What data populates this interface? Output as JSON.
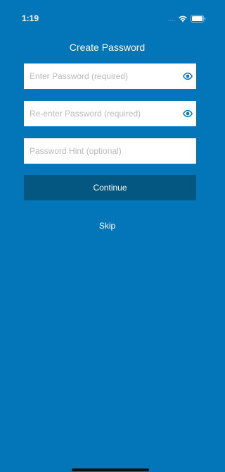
{
  "status_bar": {
    "time": "1:19",
    "signal_text": "....",
    "wifi_icon": "wifi-icon",
    "battery_icon": "battery-icon"
  },
  "title": "Create Password",
  "fields": {
    "password": {
      "placeholder": "Enter Password (required)",
      "value": "",
      "icon": "eye-icon"
    },
    "confirm": {
      "placeholder": "Re-enter Password (required)",
      "value": "",
      "icon": "eye-icon"
    },
    "hint": {
      "placeholder": "Password Hint (optional)",
      "value": ""
    }
  },
  "continue_label": "Continue",
  "skip_label": "Skip",
  "colors": {
    "background": "#0276b8",
    "button": "#035780",
    "eye_icon": "#0276b8",
    "placeholder": "#b9b9b9"
  }
}
